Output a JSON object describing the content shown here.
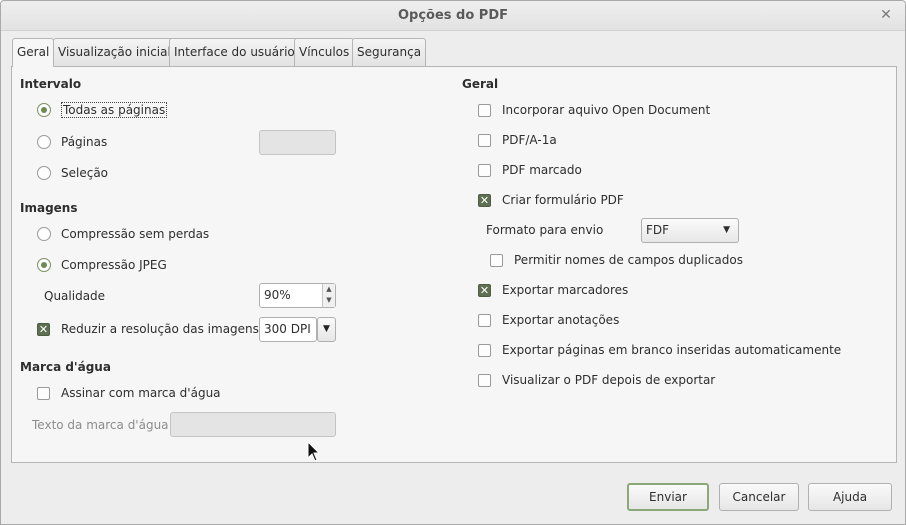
{
  "window": {
    "title": "Opções do PDF",
    "close_icon": "close-icon"
  },
  "tabs": [
    {
      "label": "Geral",
      "active": true
    },
    {
      "label": "Visualização inicial",
      "active": false
    },
    {
      "label": "Interface do usuário",
      "active": false
    },
    {
      "label": "Vínculos",
      "active": false
    },
    {
      "label": "Segurança",
      "active": false
    }
  ],
  "intervalo": {
    "title": "Intervalo",
    "all_pages": "Todas as páginas",
    "pages": "Páginas",
    "pages_value": "",
    "selection": "Seleção",
    "selected": "all_pages"
  },
  "imagens": {
    "title": "Imagens",
    "lossless": "Compressão sem perdas",
    "jpeg": "Compressão JPEG",
    "selected": "jpeg",
    "quality_label": "Qualidade",
    "quality_value": "90%",
    "reduce_label": "Reduzir a resolução das imagens",
    "reduce_checked": true,
    "resolution_value": "300 DPI"
  },
  "watermark": {
    "title": "Marca d'água",
    "sign_label": "Assinar com marca d'água",
    "sign_checked": false,
    "text_label": "Texto da marca d'água",
    "text_value": ""
  },
  "geral": {
    "title": "Geral",
    "embed_odf": "Incorporar aquivo Open Document",
    "pdfa": "PDF/A-1a",
    "tagged": "PDF marcado",
    "create_form": "Criar formulário PDF",
    "submit_format_label": "Formato para envio",
    "submit_format_value": "FDF",
    "allow_duplicate": "Permitir nomes de campos duplicados",
    "export_bookmarks": "Exportar marcadores",
    "export_comments": "Exportar anotações",
    "export_blank": "Exportar páginas em branco inseridas automaticamente",
    "view_after": "Visualizar o PDF depois de exportar",
    "checked": {
      "embed_odf": false,
      "pdfa": false,
      "tagged": false,
      "create_form": true,
      "allow_duplicate": false,
      "export_bookmarks": true,
      "export_comments": false,
      "export_blank": false,
      "view_after": false
    }
  },
  "buttons": {
    "export": "Enviar",
    "cancel": "Cancelar",
    "help": "Ajuda"
  }
}
